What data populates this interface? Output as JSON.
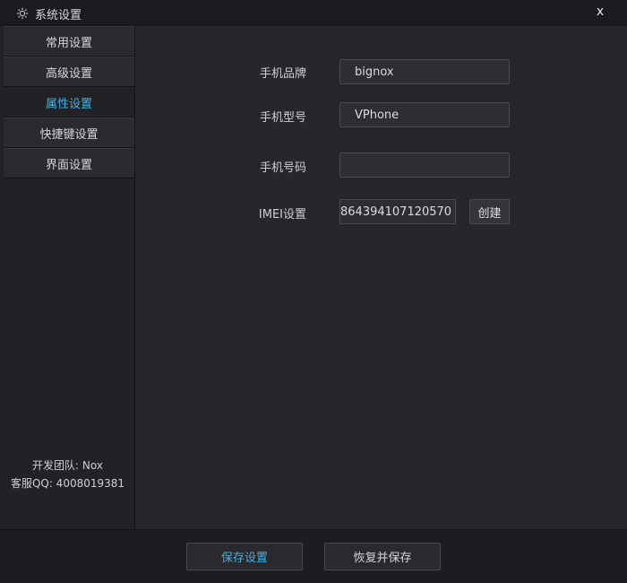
{
  "window": {
    "title": "系统设置",
    "icon": "gear-icon",
    "close_label": "x"
  },
  "sidebar": {
    "items": [
      {
        "label": "常用设置",
        "active": false
      },
      {
        "label": "高级设置",
        "active": false
      },
      {
        "label": "属性设置",
        "active": true
      },
      {
        "label": "快捷键设置",
        "active": false
      },
      {
        "label": "界面设置",
        "active": false
      }
    ],
    "footer": {
      "team": "开发团队: Nox",
      "support": "客服QQ: 4008019381"
    }
  },
  "form": {
    "brand": {
      "label": "手机品牌",
      "value": "bignox"
    },
    "model": {
      "label": "手机型号",
      "value": "VPhone"
    },
    "phone": {
      "label": "手机号码",
      "value": ""
    },
    "imei": {
      "label": "IMEI设置",
      "value": "864394107120570",
      "create_label": "创建"
    }
  },
  "footer": {
    "save_label": "保存设置",
    "restore_label": "恢复并保存"
  },
  "colors": {
    "accent": "#3fb4e8",
    "background": "#27262b",
    "sidebar": "#222126"
  }
}
